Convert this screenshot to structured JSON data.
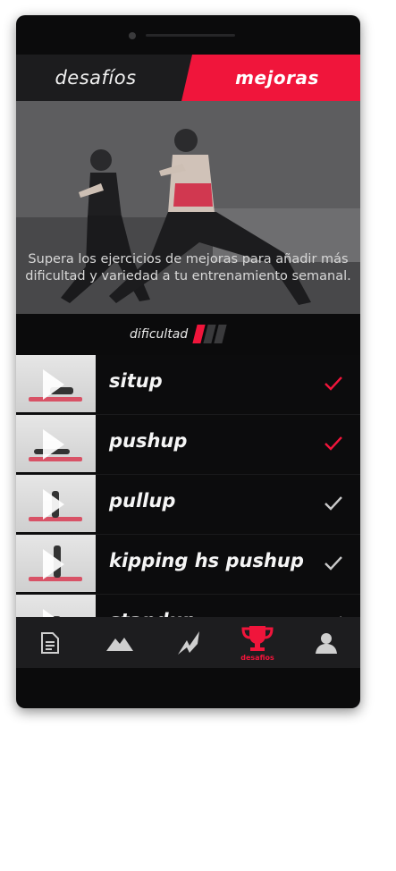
{
  "tabs": {
    "left": "desafíos",
    "right": "mejoras"
  },
  "hero": {
    "text": "Supera los ejercicios de mejoras para añadir más dificultad y variedad a tu entrenamiento semanal."
  },
  "difficulty": {
    "label": "dificultad",
    "level": 1,
    "max": 3,
    "active_color": "#f0153b",
    "inactive_color": "#3a3a3c"
  },
  "exercises": [
    {
      "name": "situp",
      "completed": true
    },
    {
      "name": "pushup",
      "completed": true
    },
    {
      "name": "pullup",
      "completed": false
    },
    {
      "name": "kipping hs pushup",
      "completed": false
    },
    {
      "name": "standup",
      "completed": false
    }
  ],
  "nav": {
    "active_label": "desafios"
  },
  "colors": {
    "accent": "#f0153b",
    "check_inactive": "#c8c8c8"
  }
}
